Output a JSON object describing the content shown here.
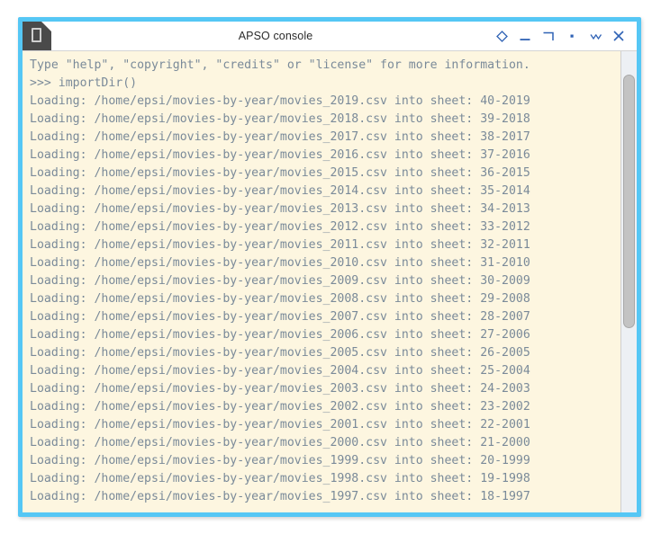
{
  "window": {
    "title": "APSO console",
    "app_icon": "document-icon",
    "border_color": "#55c7f5",
    "titlebar_bg": "#ffffff",
    "console_bg": "#fdf6e0",
    "console_text_color": "#7a8a99"
  },
  "titlebar_buttons": [
    {
      "name": "shade-button",
      "icon": "diamond-icon",
      "label": "◇"
    },
    {
      "name": "minimize-button",
      "icon": "minimize-icon",
      "label": "—"
    },
    {
      "name": "maximize-button",
      "icon": "maximize-icon",
      "label": "┐"
    },
    {
      "name": "dot-button",
      "icon": "dot-icon",
      "label": "▪"
    },
    {
      "name": "collapse-button",
      "icon": "chevron-double-down-icon",
      "label": "ˇ"
    },
    {
      "name": "close-button",
      "icon": "close-icon",
      "label": "✕"
    }
  ],
  "console": {
    "lines": [
      "Type \"help\", \"copyright\", \"credits\" or \"license\" for more information.",
      ">>> importDir()",
      "Loading: /home/epsi/movies-by-year/movies_2019.csv into sheet: 40-2019",
      "Loading: /home/epsi/movies-by-year/movies_2018.csv into sheet: 39-2018",
      "Loading: /home/epsi/movies-by-year/movies_2017.csv into sheet: 38-2017",
      "Loading: /home/epsi/movies-by-year/movies_2016.csv into sheet: 37-2016",
      "Loading: /home/epsi/movies-by-year/movies_2015.csv into sheet: 36-2015",
      "Loading: /home/epsi/movies-by-year/movies_2014.csv into sheet: 35-2014",
      "Loading: /home/epsi/movies-by-year/movies_2013.csv into sheet: 34-2013",
      "Loading: /home/epsi/movies-by-year/movies_2012.csv into sheet: 33-2012",
      "Loading: /home/epsi/movies-by-year/movies_2011.csv into sheet: 32-2011",
      "Loading: /home/epsi/movies-by-year/movies_2010.csv into sheet: 31-2010",
      "Loading: /home/epsi/movies-by-year/movies_2009.csv into sheet: 30-2009",
      "Loading: /home/epsi/movies-by-year/movies_2008.csv into sheet: 29-2008",
      "Loading: /home/epsi/movies-by-year/movies_2007.csv into sheet: 28-2007",
      "Loading: /home/epsi/movies-by-year/movies_2006.csv into sheet: 27-2006",
      "Loading: /home/epsi/movies-by-year/movies_2005.csv into sheet: 26-2005",
      "Loading: /home/epsi/movies-by-year/movies_2004.csv into sheet: 25-2004",
      "Loading: /home/epsi/movies-by-year/movies_2003.csv into sheet: 24-2003",
      "Loading: /home/epsi/movies-by-year/movies_2002.csv into sheet: 23-2002",
      "Loading: /home/epsi/movies-by-year/movies_2001.csv into sheet: 22-2001",
      "Loading: /home/epsi/movies-by-year/movies_2000.csv into sheet: 21-2000",
      "Loading: /home/epsi/movies-by-year/movies_1999.csv into sheet: 20-1999",
      "Loading: /home/epsi/movies-by-year/movies_1998.csv into sheet: 19-1998",
      "Loading: /home/epsi/movies-by-year/movies_1997.csv into sheet: 18-1997"
    ]
  },
  "scrollbar": {
    "thumb_top_pct": 5,
    "thumb_height_pct": 55
  }
}
